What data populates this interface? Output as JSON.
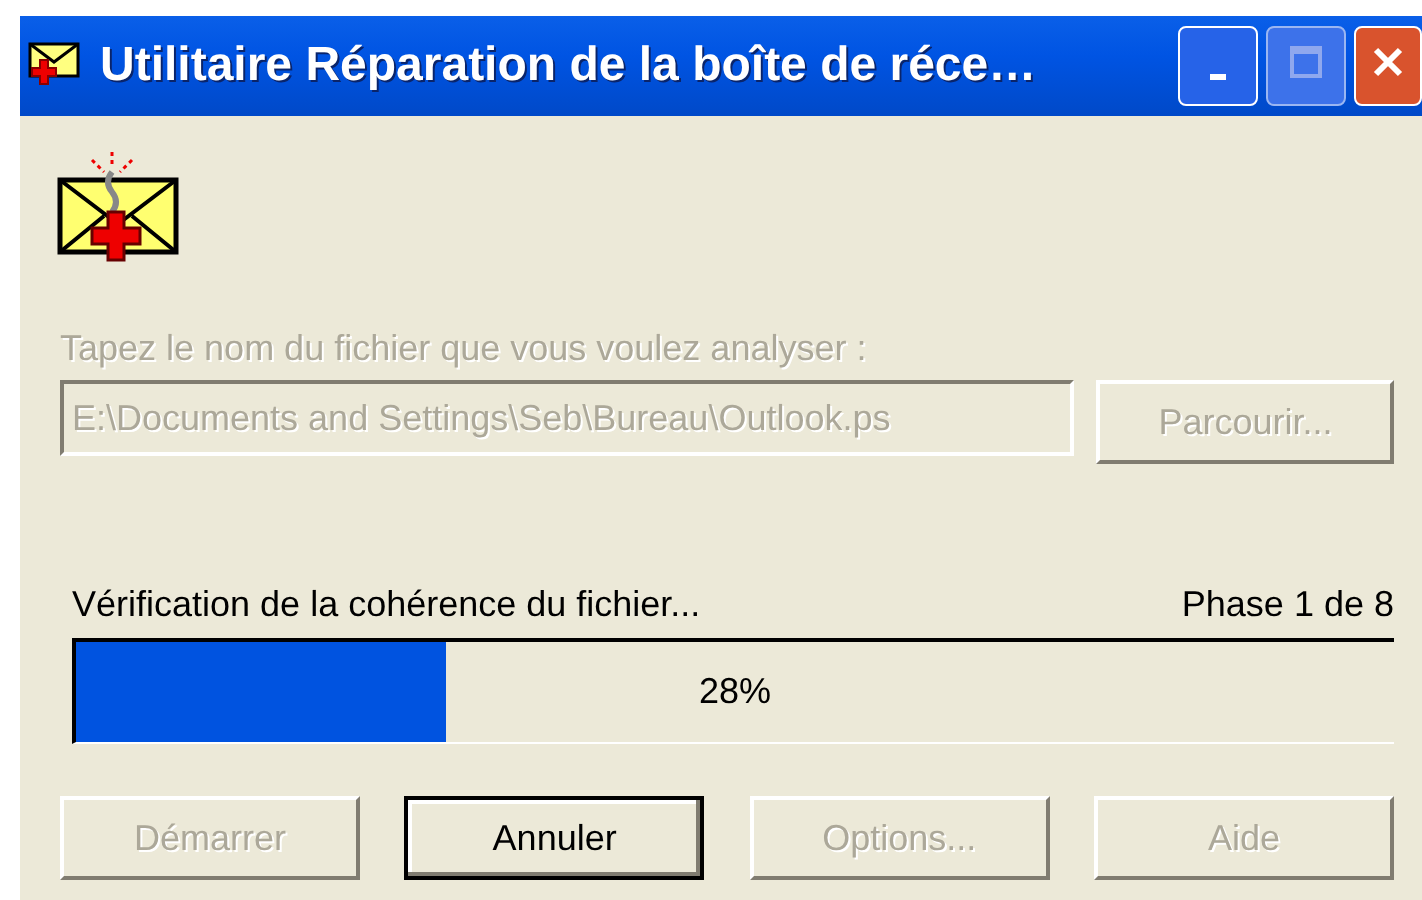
{
  "window": {
    "title": "Utilitaire Réparation de la boîte de réce…"
  },
  "file_prompt": {
    "label": "Tapez le nom du fichier que vous voulez analyser :",
    "disabled": true
  },
  "file_field": {
    "value": "E:\\Documents and Settings\\Seb\\Bureau\\Outlook.ps",
    "disabled": true
  },
  "browse_button": {
    "label": "Parcourir...",
    "disabled": true
  },
  "status": {
    "text": "Vérification de la cohérence du fichier...",
    "phase": "Phase 1 de 8"
  },
  "progress": {
    "level": 0.28,
    "reading": "28%"
  },
  "buttons": [
    {
      "label": "Démarrer",
      "disabled": true,
      "default": false
    },
    {
      "label": "Annuler",
      "disabled": false,
      "default": true
    },
    {
      "label": "Options...",
      "disabled": true,
      "default": false
    },
    {
      "label": "Aide",
      "disabled": true,
      "default": false
    }
  ]
}
